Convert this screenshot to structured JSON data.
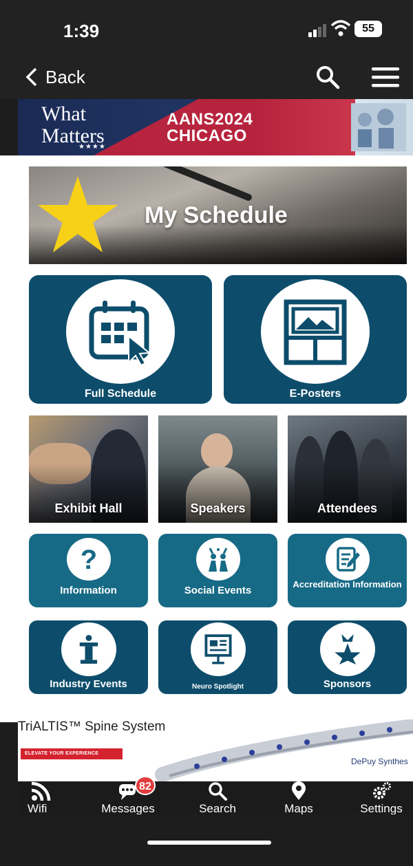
{
  "status_bar": {
    "time": "1:39",
    "battery": "55"
  },
  "nav": {
    "back_label": "Back"
  },
  "banner": {
    "logo_line1": "What",
    "logo_line2": "Matters",
    "logo_stars": "★★★★",
    "title_line1": "AANS2024",
    "title_line2": "CHICAGO"
  },
  "hero": {
    "label": "My Schedule"
  },
  "big_tiles": [
    {
      "label": "Full Schedule",
      "icon": "calendar-icon"
    },
    {
      "label": "E-Posters",
      "icon": "poster-icon"
    }
  ],
  "photo_tiles": [
    {
      "label": "Exhibit Hall"
    },
    {
      "label": "Speakers"
    },
    {
      "label": "Attendees"
    }
  ],
  "small_tiles": [
    {
      "label": "Information",
      "icon": "question-icon"
    },
    {
      "label": "Social Events",
      "icon": "celebration-icon"
    },
    {
      "label": "Accreditation Information",
      "icon": "edit-document-icon"
    },
    {
      "label": "Industry Events",
      "icon": "podium-icon"
    },
    {
      "label": "Neuro Spotlight",
      "icon": "presentation-icon"
    },
    {
      "label": "Sponsors",
      "icon": "medal-star-icon"
    }
  ],
  "ad": {
    "title": "TriALTIS™ Spine System",
    "badge": "ELEVATE YOUR EXPERIENCE",
    "brand": "DePuy Synthes"
  },
  "tab_bar": {
    "items": [
      {
        "label": "Wifi",
        "icon": "wifi-icon"
      },
      {
        "label": "Messages",
        "icon": "messages-icon",
        "badge": "82"
      },
      {
        "label": "Search",
        "icon": "search-icon"
      },
      {
        "label": "Maps",
        "icon": "map-pin-icon"
      },
      {
        "label": "Settings",
        "icon": "gears-icon"
      }
    ]
  },
  "colors": {
    "tile_dark": "#0d4d6b",
    "tile_mid": "#176a86",
    "star": "#f7d117",
    "badge_red": "#e23b3b"
  }
}
